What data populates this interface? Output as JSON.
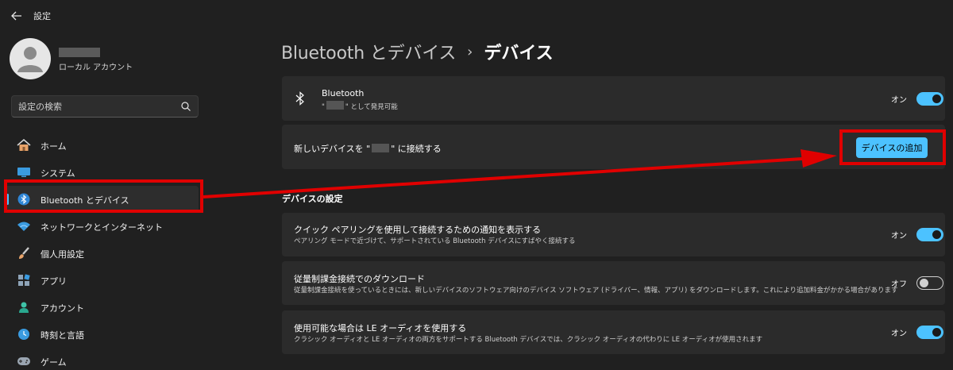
{
  "window": {
    "title": "設定"
  },
  "profile": {
    "account_type": "ローカル アカウント"
  },
  "search": {
    "placeholder": "設定の検索"
  },
  "sidebar": {
    "items": [
      {
        "label": "ホーム",
        "icon": "home-icon"
      },
      {
        "label": "システム",
        "icon": "system-icon"
      },
      {
        "label": "Bluetooth とデバイス",
        "icon": "bluetooth-icon",
        "active": true
      },
      {
        "label": "ネットワークとインターネット",
        "icon": "wifi-icon"
      },
      {
        "label": "個人用設定",
        "icon": "brush-icon"
      },
      {
        "label": "アプリ",
        "icon": "apps-icon"
      },
      {
        "label": "アカウント",
        "icon": "person-icon"
      },
      {
        "label": "時刻と言語",
        "icon": "globe-clock-icon"
      },
      {
        "label": "ゲーム",
        "icon": "gamepad-icon"
      }
    ]
  },
  "breadcrumb": {
    "parent": "Bluetooth とデバイス",
    "separator": "›",
    "current": "デバイス"
  },
  "bluetooth_card": {
    "title": "Bluetooth",
    "desc_prefix": "\"",
    "desc_suffix": "\" として発見可能",
    "toggle_label": "オン"
  },
  "add_device_card": {
    "text_prefix": "新しいデバイスを \"",
    "text_suffix": "\" に接続する",
    "button_label": "デバイスの追加"
  },
  "device_settings": {
    "section_title": "デバイスの設定",
    "items": [
      {
        "title": "クイック ペアリングを使用して接続するための通知を表示する",
        "desc": "ペアリング モードで近づけて、サポートされている Bluetooth デバイスにすばやく接続する",
        "toggle_label": "オン",
        "on": true
      },
      {
        "title": "従量制課金接続でのダウンロード",
        "desc": "従量制課金接続を使っているときには、新しいデバイスのソフトウェア向けのデバイス ソフトウェア (ドライバー、情報、アプリ) をダウンロードします。これにより追加料金がかかる場合があります",
        "toggle_label": "オフ",
        "on": false
      },
      {
        "title": "使用可能な場合は LE オーディオを使用する",
        "desc": "クラシック オーディオと LE オーディオの両方をサポートする Bluetooth デバイスでは、クラシック オーディオの代わりに LE オーディオが使用されます",
        "toggle_label": "オン",
        "on": true
      }
    ]
  },
  "colors": {
    "accent": "#4cc2ff",
    "background": "#202020",
    "card": "#2b2b2b",
    "highlight": "#e00000"
  }
}
